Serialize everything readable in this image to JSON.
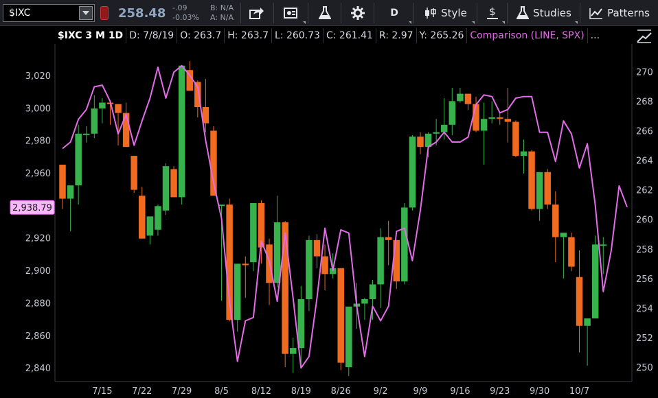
{
  "toolbar": {
    "symbol": "$IXC",
    "last_price": "258.48",
    "change": "-.09",
    "change_pct": "-0.03%",
    "bid": "B: N/A",
    "ask": "A: N/A",
    "period_label": "D",
    "style_label": "Style",
    "studies_label": "Studies",
    "patterns_label": "Patterns",
    "icons": [
      "share-icon",
      "news-icon",
      "flask-icon",
      "gear-icon",
      "candlestick-icon",
      "dollar-icon",
      "flask-icon",
      "drawing-icon"
    ]
  },
  "header": {
    "symbol_period": "$IXC 3 M 1D",
    "date": "D: 7/8/19",
    "open": "O: 263.7",
    "high": "H: 263.7",
    "low": "L: 260.73",
    "close": "C: 261.41",
    "range": "R: 2.97",
    "prev": "Y: 265.26",
    "comparison": "Comparison (LINE, SPX)",
    "more": "..."
  },
  "colors": {
    "up": "#37b24d",
    "down": "#f06a20",
    "comparison": "#e36ce8",
    "axis_text": "#c4c8d0",
    "background": "#000000",
    "tag_bg": "#f6b8f8"
  },
  "chart_data": {
    "type": "candlestick",
    "title": "",
    "comparison_label": "2,938.79",
    "x_ticks": [
      "7/15",
      "7/22",
      "7/29",
      "8/5",
      "8/12",
      "8/19",
      "8/26",
      "9/2",
      "9/9",
      "9/16",
      "9/23",
      "9/30",
      "10/7"
    ],
    "left_axis": {
      "ticks": [
        "3,020",
        "3,000",
        "2,980",
        "2,960",
        "2,940",
        "2,920",
        "2,900",
        "2,880",
        "2,860",
        "2,840"
      ],
      "range": [
        2835,
        3036
      ]
    },
    "right_axis": {
      "ticks": [
        "270",
        "268",
        "266",
        "264",
        "262",
        "260",
        "258",
        "256",
        "254",
        "252",
        "250"
      ],
      "range": [
        249.4,
        271.5
      ]
    },
    "ohlc_series": {
      "name": "$IXC",
      "axis": "right",
      "candles": [
        {
          "o": 263.7,
          "h": 263.7,
          "l": 260.7,
          "c": 261.4
        },
        {
          "o": 261.4,
          "h": 262.0,
          "l": 259.2,
          "c": 262.3
        },
        {
          "o": 262.3,
          "h": 266.4,
          "l": 261.0,
          "c": 265.8
        },
        {
          "o": 265.8,
          "h": 266.3,
          "l": 265.2,
          "c": 265.8
        },
        {
          "o": 265.8,
          "h": 268.4,
          "l": 265.5,
          "c": 267.5
        },
        {
          "o": 267.5,
          "h": 268.2,
          "l": 266.5,
          "c": 267.9
        },
        {
          "o": 267.9,
          "h": 268.0,
          "l": 266.4,
          "c": 267.8
        },
        {
          "o": 267.8,
          "h": 267.8,
          "l": 265.0,
          "c": 267.2
        },
        {
          "o": 267.2,
          "h": 267.9,
          "l": 265.7,
          "c": 264.9
        },
        {
          "o": 264.3,
          "h": 264.3,
          "l": 261.8,
          "c": 262.0
        },
        {
          "o": 261.6,
          "h": 262.2,
          "l": 258.7,
          "c": 258.7
        },
        {
          "o": 258.9,
          "h": 260.0,
          "l": 258.3,
          "c": 260.2
        },
        {
          "o": 259.3,
          "h": 261.0,
          "l": 258.9,
          "c": 260.9
        },
        {
          "o": 260.6,
          "h": 263.8,
          "l": 260.3,
          "c": 263.6
        },
        {
          "o": 263.4,
          "h": 263.6,
          "l": 261.5,
          "c": 261.5
        },
        {
          "o": 261.5,
          "h": 265.0,
          "l": 261.0,
          "c": 270.4
        },
        {
          "o": 270.1,
          "h": 270.7,
          "l": 268.7,
          "c": 268.7
        },
        {
          "o": 269.3,
          "h": 269.4,
          "l": 266.9,
          "c": 267.6
        },
        {
          "o": 267.6,
          "h": 269.5,
          "l": 265.9,
          "c": 266.5
        },
        {
          "o": 266.0,
          "h": 266.3,
          "l": 261.6,
          "c": 261.6
        },
        {
          "o": 260.9,
          "h": 261.0,
          "l": 254.5,
          "c": 261.0
        },
        {
          "o": 261.0,
          "h": 261.4,
          "l": 253.1,
          "c": 253.2
        },
        {
          "o": 253.2,
          "h": 256.9,
          "l": 252.4,
          "c": 257.0
        },
        {
          "o": 257.0,
          "h": 257.5,
          "l": 254.7,
          "c": 256.9
        },
        {
          "o": 257.1,
          "h": 261.0,
          "l": 256.5,
          "c": 261.1
        },
        {
          "o": 261.1,
          "h": 261.3,
          "l": 257.0,
          "c": 258.1
        },
        {
          "o": 258.3,
          "h": 258.7,
          "l": 254.2,
          "c": 255.7
        },
        {
          "o": 255.7,
          "h": 261.6,
          "l": 255.4,
          "c": 259.8
        },
        {
          "o": 259.8,
          "h": 259.9,
          "l": 250.0,
          "c": 250.9
        },
        {
          "o": 250.9,
          "h": 252.0,
          "l": 249.6,
          "c": 251.3
        },
        {
          "o": 251.3,
          "h": 255.5,
          "l": 250.0,
          "c": 254.6
        },
        {
          "o": 254.6,
          "h": 258.9,
          "l": 253.8,
          "c": 258.6
        },
        {
          "o": 258.6,
          "h": 259.0,
          "l": 256.7,
          "c": 257.5
        },
        {
          "o": 257.5,
          "h": 258.3,
          "l": 255.2,
          "c": 256.3
        },
        {
          "o": 256.3,
          "h": 257.7,
          "l": 256.0,
          "c": 256.7
        },
        {
          "o": 256.7,
          "h": 256.7,
          "l": 249.8,
          "c": 250.3
        },
        {
          "o": 250.0,
          "h": 253.8,
          "l": 249.4,
          "c": 254.1
        },
        {
          "o": 254.1,
          "h": 255.7,
          "l": 252.6,
          "c": 254.3
        },
        {
          "o": 254.3,
          "h": 254.7,
          "l": 253.2,
          "c": 254.6
        },
        {
          "o": 254.6,
          "h": 255.9,
          "l": 253.2,
          "c": 255.6
        },
        {
          "o": 255.6,
          "h": 259.4,
          "l": 254.0,
          "c": 258.8
        },
        {
          "o": 258.8,
          "h": 259.9,
          "l": 256.9,
          "c": 258.6
        },
        {
          "o": 258.6,
          "h": 258.6,
          "l": 255.3,
          "c": 255.8
        },
        {
          "o": 255.8,
          "h": 261.1,
          "l": 255.6,
          "c": 260.8
        },
        {
          "o": 260.8,
          "h": 265.7,
          "l": 260.6,
          "c": 265.6
        },
        {
          "o": 265.6,
          "h": 265.9,
          "l": 264.4,
          "c": 264.9
        },
        {
          "o": 264.9,
          "h": 265.9,
          "l": 264.2,
          "c": 265.8
        },
        {
          "o": 265.8,
          "h": 266.8,
          "l": 265.0,
          "c": 265.9
        },
        {
          "o": 265.9,
          "h": 268.2,
          "l": 265.4,
          "c": 266.4
        },
        {
          "o": 266.4,
          "h": 268.9,
          "l": 265.7,
          "c": 268.0
        },
        {
          "o": 268.0,
          "h": 268.9,
          "l": 267.9,
          "c": 268.5
        },
        {
          "o": 268.5,
          "h": 268.5,
          "l": 267.4,
          "c": 267.8
        },
        {
          "o": 267.8,
          "h": 268.3,
          "l": 265.9,
          "c": 266.0
        },
        {
          "o": 266.0,
          "h": 267.9,
          "l": 263.7,
          "c": 266.8
        },
        {
          "o": 266.8,
          "h": 268.0,
          "l": 266.5,
          "c": 266.9
        },
        {
          "o": 266.9,
          "h": 267.3,
          "l": 266.4,
          "c": 266.8
        },
        {
          "o": 266.8,
          "h": 268.9,
          "l": 265.2,
          "c": 266.6
        },
        {
          "o": 266.6,
          "h": 266.7,
          "l": 264.2,
          "c": 264.3
        },
        {
          "o": 264.3,
          "h": 265.4,
          "l": 263.1,
          "c": 264.6
        },
        {
          "o": 264.6,
          "h": 264.7,
          "l": 260.6,
          "c": 260.7
        },
        {
          "o": 260.7,
          "h": 263.2,
          "l": 259.9,
          "c": 263.2
        },
        {
          "o": 263.2,
          "h": 263.4,
          "l": 260.7,
          "c": 261.0
        },
        {
          "o": 261.0,
          "h": 261.9,
          "l": 257.1,
          "c": 258.8
        },
        {
          "o": 258.8,
          "h": 258.9,
          "l": 256.0,
          "c": 259.1
        },
        {
          "o": 258.8,
          "h": 259.1,
          "l": 256.5,
          "c": 256.8
        },
        {
          "o": 256.1,
          "h": 257.9,
          "l": 251.0,
          "c": 252.8
        },
        {
          "o": 252.8,
          "h": 253.0,
          "l": 250.1,
          "c": 253.3
        },
        {
          "o": 253.3,
          "h": 258.9,
          "l": 253.3,
          "c": 258.3
        },
        {
          "o": 258.3,
          "h": 258.8,
          "l": 256.3,
          "c": 258.3
        }
      ]
    },
    "comparison_series": {
      "name": "SPX",
      "axis": "left",
      "values": [
        2975,
        2979,
        2993,
        2999,
        3013,
        3014,
        3004,
        2984,
        2996,
        2977,
        2992,
        3006,
        3025,
        3006,
        3022,
        3026,
        3020,
        3013,
        2980,
        2954,
        2932,
        2881,
        2844,
        2869,
        2871,
        2918,
        2906,
        2881,
        2923,
        2883,
        2840,
        2847,
        2883,
        2926,
        2900,
        2925,
        2923,
        2878,
        2847,
        2878,
        2869,
        2878,
        2924,
        2926,
        2906,
        2937,
        2976,
        2979,
        2985,
        2979,
        2979,
        2982,
        3002,
        3008,
        3007,
        2997,
        2999,
        3006,
        3007,
        3007,
        2985,
        2985,
        2967,
        2992,
        2984,
        2963,
        2978,
        2940,
        2887,
        2912,
        2952,
        2939
      ]
    }
  }
}
